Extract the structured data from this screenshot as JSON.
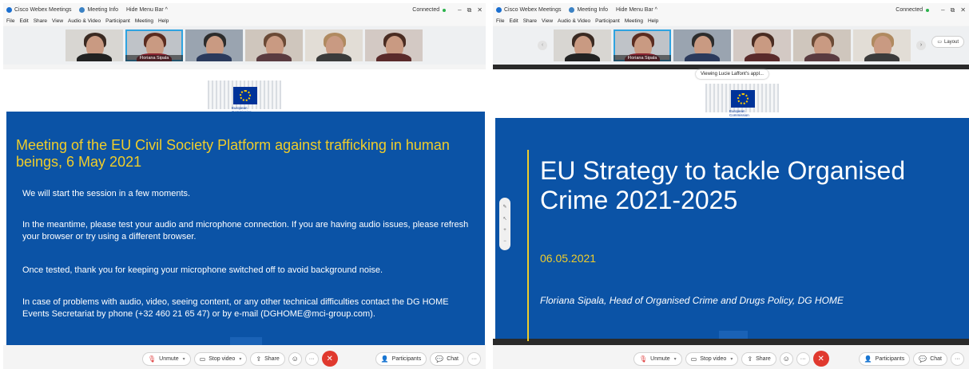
{
  "left": {
    "titlebar": {
      "app_name": "Cisco Webex Meetings",
      "meeting_info": "Meeting Info",
      "hide_menu_bar": "Hide Menu Bar ^",
      "connected": "Connected",
      "min": "–",
      "restore": "⧉",
      "close": "✕"
    },
    "menu": [
      "File",
      "Edit",
      "Share",
      "View",
      "Audio & Video",
      "Participant",
      "Meeting",
      "Help"
    ],
    "thumbnails": [
      {
        "name": "",
        "hair": "#3a2a22",
        "body": "#222222"
      },
      {
        "name": "Floriana Sipala",
        "hair": "#5a2c20",
        "body": "#8a2430",
        "active": true
      },
      {
        "name": "",
        "hair": "#2c2c2c",
        "body": "#2b3a5c"
      },
      {
        "name": "",
        "hair": "#6b4a36",
        "body": "#5a3b40"
      },
      {
        "name": "",
        "hair": "#b08a60",
        "body": "#3b3b3b"
      },
      {
        "name": "",
        "hair": "#4a2c22",
        "body": "#5a2a2a"
      }
    ],
    "ec_label": "European\nCommission",
    "slide": {
      "title": "Meeting of the EU Civil Society Platform against trafficking in human beings, 6 May 2021",
      "p1": "We will start the session in a few moments.",
      "p2": "In the meantime, please test your audio and microphone connection. If you are having audio issues, please refresh your browser or try using a different browser.",
      "p3": "Once tested, thank you for keeping your microphone switched off to avoid background noise.",
      "p4": "In case of problems with audio, video, seeing content, or any other technical difficulties contact the DG HOME Events Secretariat by phone (+32 460 21 65 47) or by e-mail (DGHOME@mci-group.com)."
    },
    "controls": {
      "unmute": "Unmute",
      "stop_video": "Stop video",
      "share": "Share",
      "participants": "Participants",
      "chat": "Chat",
      "more": "···"
    }
  },
  "right": {
    "titlebar": {
      "app_name": "Cisco Webex Meetings",
      "meeting_info": "Meeting Info",
      "hide_menu_bar": "Hide Menu Bar ^",
      "connected": "Connected",
      "min": "–",
      "restore": "⧉",
      "close": "✕"
    },
    "menu": [
      "File",
      "Edit",
      "Share",
      "View",
      "Audio & Video",
      "Participant",
      "Meeting",
      "Help"
    ],
    "layout_btn": "Layout",
    "viewing": "Viewing Lucie Laffont's appl...",
    "thumbnails": [
      {
        "name": "",
        "hair": "#3a2a22",
        "body": "#222222"
      },
      {
        "name": "Floriana Sipala",
        "hair": "#5a2c20",
        "body": "#8a2430",
        "active": true
      },
      {
        "name": "",
        "hair": "#2c2c2c",
        "body": "#2b3a5c"
      },
      {
        "name": "",
        "hair": "#4a2c22",
        "body": "#5a2a2a"
      },
      {
        "name": "",
        "hair": "#6b4a36",
        "body": "#5a3b40"
      },
      {
        "name": "",
        "hair": "#b08a60",
        "body": "#3b3b3b"
      }
    ],
    "ec_label": "European\nCommission",
    "slide": {
      "title": "EU Strategy to tackle Organised Crime 2021-2025",
      "date": "06.05.2021",
      "speaker": "Floriana Sipala, Head of Organised Crime and Drugs Policy, DG HOME"
    },
    "controls": {
      "unmute": "Unmute",
      "stop_video": "Stop video",
      "share": "Share",
      "participants": "Participants",
      "chat": "Chat",
      "more": "···"
    }
  },
  "colors": {
    "slide_blue": "#0b53a6",
    "title_yellow": "#f0cd2a",
    "end_call": "#e0392e",
    "active_thumb": "#2ea3e0"
  }
}
